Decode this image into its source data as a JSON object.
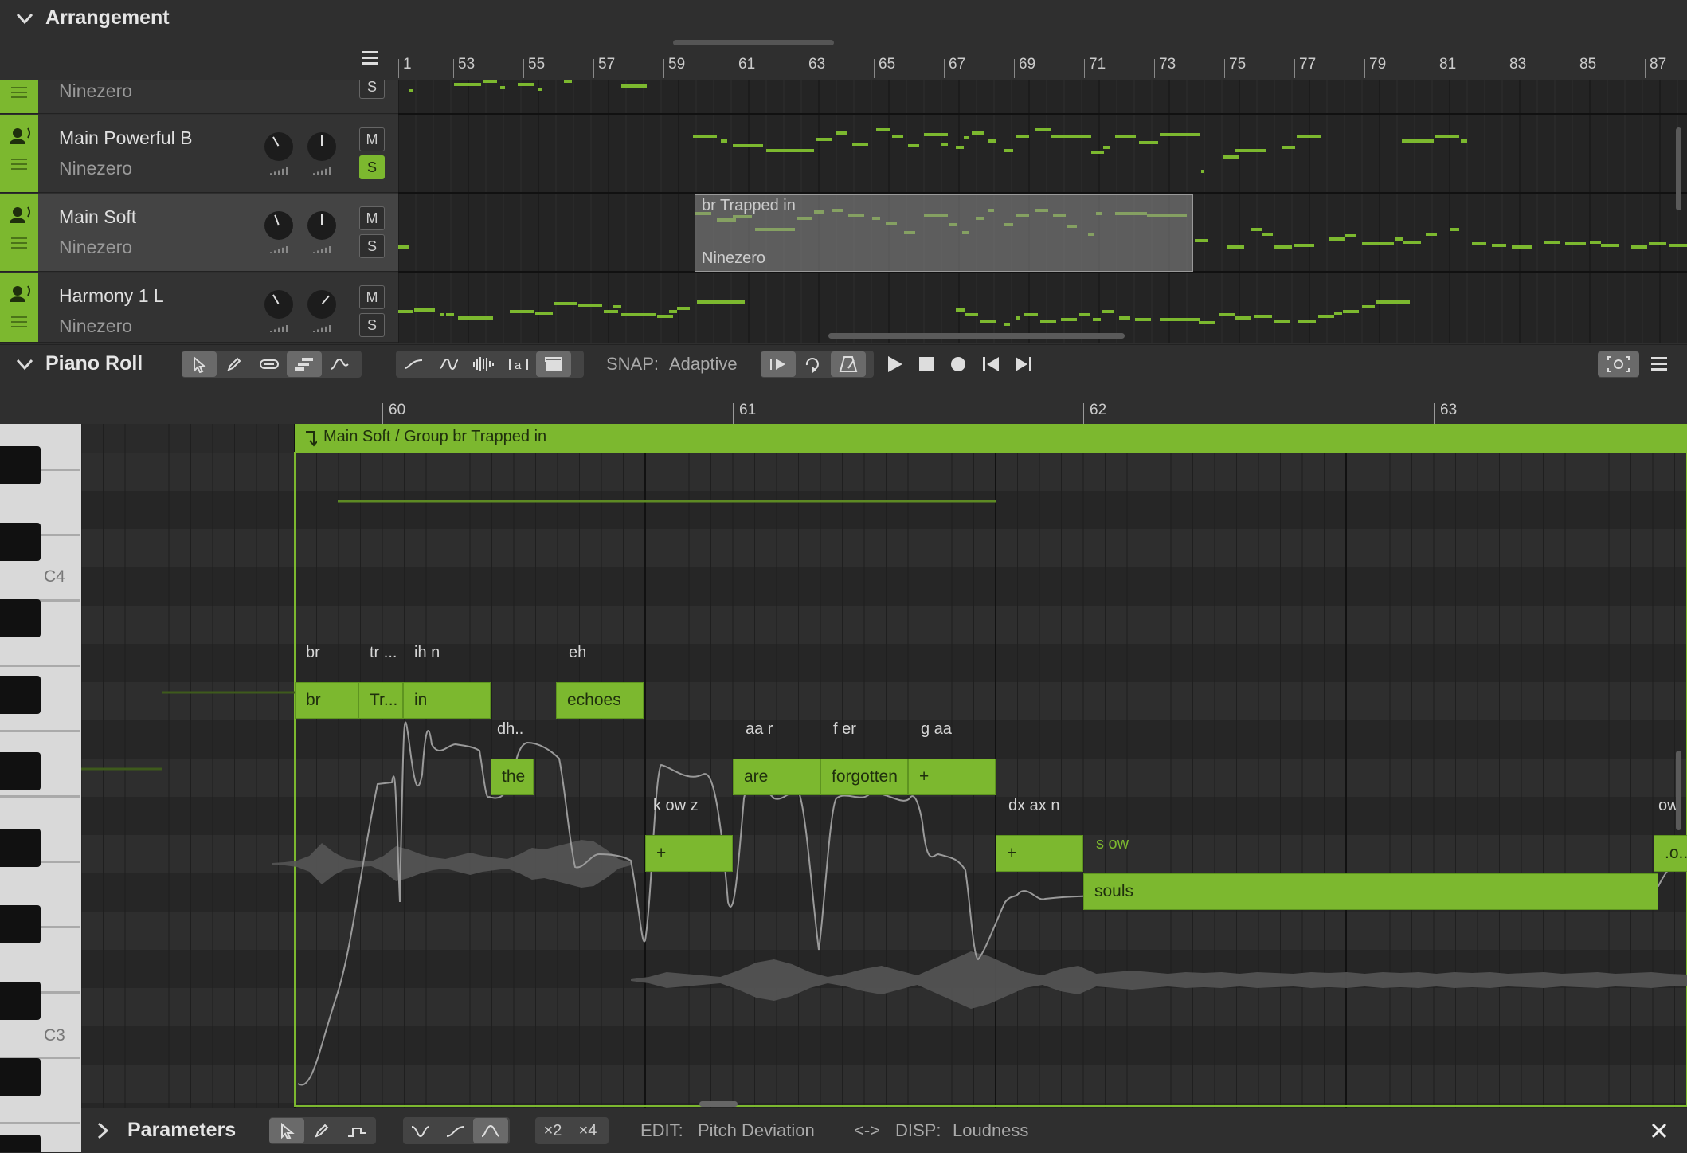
{
  "arrangement": {
    "title": "Arrangement",
    "ruler": [
      "1",
      "53",
      "55",
      "57",
      "59",
      "61",
      "63",
      "65",
      "67",
      "69",
      "71",
      "73",
      "75",
      "77",
      "79",
      "81",
      "83",
      "85",
      "87"
    ],
    "tracks": [
      {
        "name": "",
        "singer": "Ninezero",
        "mute": "M",
        "solo": "S",
        "solo_on": false,
        "active": false
      },
      {
        "name": "Main Powerful B",
        "singer": "Ninezero",
        "mute": "M",
        "solo": "S",
        "solo_on": true,
        "active": false
      },
      {
        "name": "Main Soft",
        "singer": "Ninezero",
        "mute": "M",
        "solo": "S",
        "solo_on": false,
        "active": true
      },
      {
        "name": "Harmony 1 L",
        "singer": "Ninezero",
        "mute": "M",
        "solo": "S",
        "solo_on": false,
        "active": false
      }
    ],
    "group": {
      "title": "br Trapped in",
      "singer": "Ninezero"
    }
  },
  "piano_roll": {
    "title": "Piano Roll",
    "snap_label": "SNAP:",
    "snap_value": "Adaptive",
    "ruler": [
      "60",
      "61",
      "62",
      "63"
    ],
    "group_header": "Main Soft / Group br Trapped in",
    "key_labels": {
      "c4": "C4",
      "c3": "C3"
    },
    "notes": [
      {
        "lyric": "br",
        "phonemes": "br"
      },
      {
        "lyric": "Tr...",
        "phonemes": "tr ..."
      },
      {
        "lyric": "in",
        "phonemes": "ih n"
      },
      {
        "lyric": "the",
        "phonemes": "dh.."
      },
      {
        "lyric": "echoes",
        "phonemes": "eh"
      },
      {
        "lyric": "+",
        "phonemes": "k ow z"
      },
      {
        "lyric": "are",
        "phonemes": "aa r"
      },
      {
        "lyric": "forgotten",
        "phonemes": "f er"
      },
      {
        "lyric": "+",
        "phonemes": "g aa"
      },
      {
        "lyric": "+",
        "phonemes": "dx ax n"
      },
      {
        "lyric": "souls",
        "phonemes": "s ow"
      },
      {
        "lyric": ".o..",
        "phonemes": "ow"
      }
    ]
  },
  "parameters": {
    "title": "Parameters",
    "zoom_x2": "×2",
    "zoom_x4": "×4",
    "edit_label": "EDIT:",
    "edit_value": "Pitch Deviation",
    "disp_label": "DISP:",
    "disp_value": "Loudness",
    "swap_glyph": "<->"
  },
  "colors": {
    "accent": "#7cb82f",
    "background": "#2b2b2b",
    "panel": "#333333"
  }
}
